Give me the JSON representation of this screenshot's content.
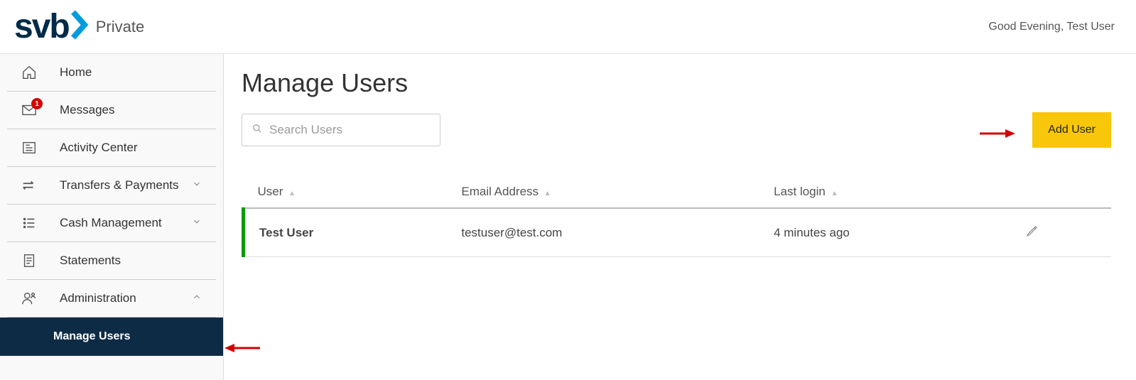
{
  "header": {
    "brand_text": "svb",
    "brand_sub": "Private",
    "greeting": "Good Evening, Test User"
  },
  "sidebar": {
    "items": [
      {
        "label": "Home",
        "icon": "home-icon"
      },
      {
        "label": "Messages",
        "icon": "envelope-icon",
        "badge": "1"
      },
      {
        "label": "Activity Center",
        "icon": "news-icon"
      },
      {
        "label": "Transfers & Payments",
        "icon": "transfers-icon",
        "expandable": true
      },
      {
        "label": "Cash Management",
        "icon": "list-icon",
        "expandable": true
      },
      {
        "label": "Statements",
        "icon": "document-icon"
      },
      {
        "label": "Administration",
        "icon": "admin-icon",
        "expandable": true,
        "expanded": true
      }
    ],
    "sub_items": [
      {
        "label": "Manage Users"
      }
    ]
  },
  "main": {
    "page_title": "Manage Users",
    "search_placeholder": "Search Users",
    "add_user_label": "Add User",
    "columns": {
      "user": "User",
      "email": "Email Address",
      "last_login": "Last login"
    },
    "rows": [
      {
        "name": "Test User",
        "email": "testuser@test.com",
        "last_login": "4 minutes ago"
      }
    ]
  },
  "colors": {
    "accent_blue": "#009cde",
    "dark_navy": "#0e2b45",
    "yellow": "#f9c709",
    "green": "#0a9b00",
    "badge_red": "#d50000"
  }
}
